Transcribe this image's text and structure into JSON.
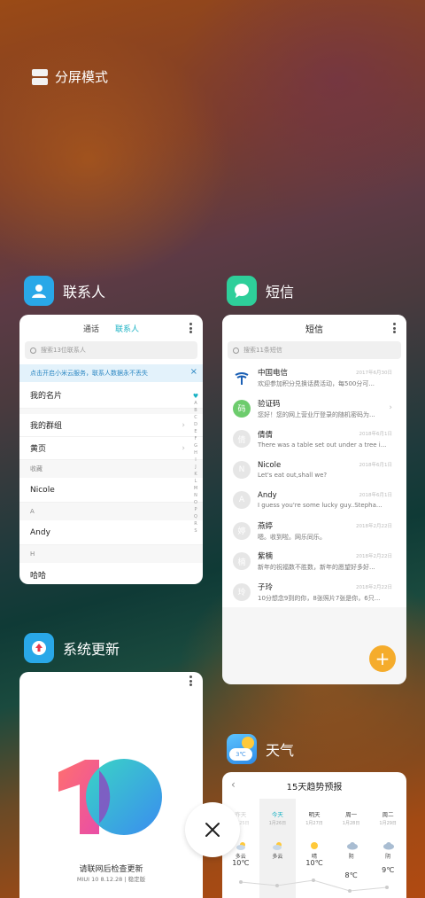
{
  "split_screen": {
    "label": "分屏模式"
  },
  "apps": {
    "contacts": {
      "name": "联系人",
      "tabs": [
        "通话",
        "联系人"
      ],
      "search_placeholder": "搜索13位联系人",
      "banner": "点击开启小米云服务，联系人数据永不丢失",
      "rows": [
        {
          "label": "我的名片"
        },
        {
          "label": "我的群组"
        },
        {
          "label": "黄页"
        }
      ],
      "section_favorites": "收藏",
      "favorite": "Nicole",
      "section_a": "A",
      "contact_a": "Andy",
      "section_h": "H",
      "contact_h": "哈哈",
      "alpha": [
        "A",
        "B",
        "C",
        "D",
        "E",
        "F",
        "G",
        "H",
        "I",
        "J",
        "K",
        "L",
        "M",
        "N",
        "O",
        "P",
        "Q",
        "R",
        "S"
      ]
    },
    "sms": {
      "name": "短信",
      "title": "短信",
      "search_placeholder": "搜索11条短信",
      "messages": [
        {
          "avatar": "",
          "name": "中国电信",
          "text": "欢迎参加积分兑换话费活动，每500分可...",
          "date": "2017年6月30日"
        },
        {
          "avatar": "码",
          "name": "验证码",
          "text": "您好！您的网上营业厅登录的随机密码为...",
          "date": ""
        },
        {
          "avatar": "倩",
          "name": "倩倩",
          "text": "There was a table set out under a tree i...",
          "date": "2018年6月1日"
        },
        {
          "avatar": "N",
          "name": "Nicole",
          "text": "Let's eat out,shall we?",
          "date": "2018年6月1日"
        },
        {
          "avatar": "A",
          "name": "Andy",
          "text": "I guess you're some lucky guy..Stepha...",
          "date": "2018年6月1日"
        },
        {
          "avatar": "婷",
          "name": "燕婷",
          "text": "嗯。收到啦。网乐同乐。",
          "date": "2018年2月22日"
        },
        {
          "avatar": "楠",
          "name": "紫楠",
          "text": "新年的祝福数不胜数，新年的愿望好多好...",
          "date": "2018年2月22日"
        },
        {
          "avatar": "玲",
          "name": "子玲",
          "text": "10分想念9到的你，8张照片7张是你，6只...",
          "date": "2018年2月22日"
        }
      ]
    },
    "updater": {
      "name": "系统更新",
      "check_text": "请联网后检查更新",
      "version": "MIUI 10 8.12.28 | 稳定版"
    },
    "weather": {
      "name": "天气",
      "icon_temp": "3℃",
      "title": "15天趋势预报",
      "days": [
        {
          "day": "昨天",
          "date": "1月25日",
          "cond": "多云",
          "temp": "10℃"
        },
        {
          "day": "今天",
          "date": "1月26日",
          "cond": "多云",
          "temp": ""
        },
        {
          "day": "明天",
          "date": "1月27日",
          "cond": "晴",
          "temp": "10℃"
        },
        {
          "day": "周一",
          "date": "1月28日",
          "cond": "阴",
          "temp": "8℃"
        },
        {
          "day": "周二",
          "date": "1月29日",
          "cond": "阴",
          "temp": "9℃"
        }
      ]
    }
  },
  "colors": {
    "contacts_icon": "#29a8e8",
    "sms_icon": "#2ecf9a",
    "updater_icon": "#29a8e8",
    "weather_icon": "#3aa0ee",
    "accent": "#1ab2c4",
    "fab": "#f5ac2c"
  }
}
